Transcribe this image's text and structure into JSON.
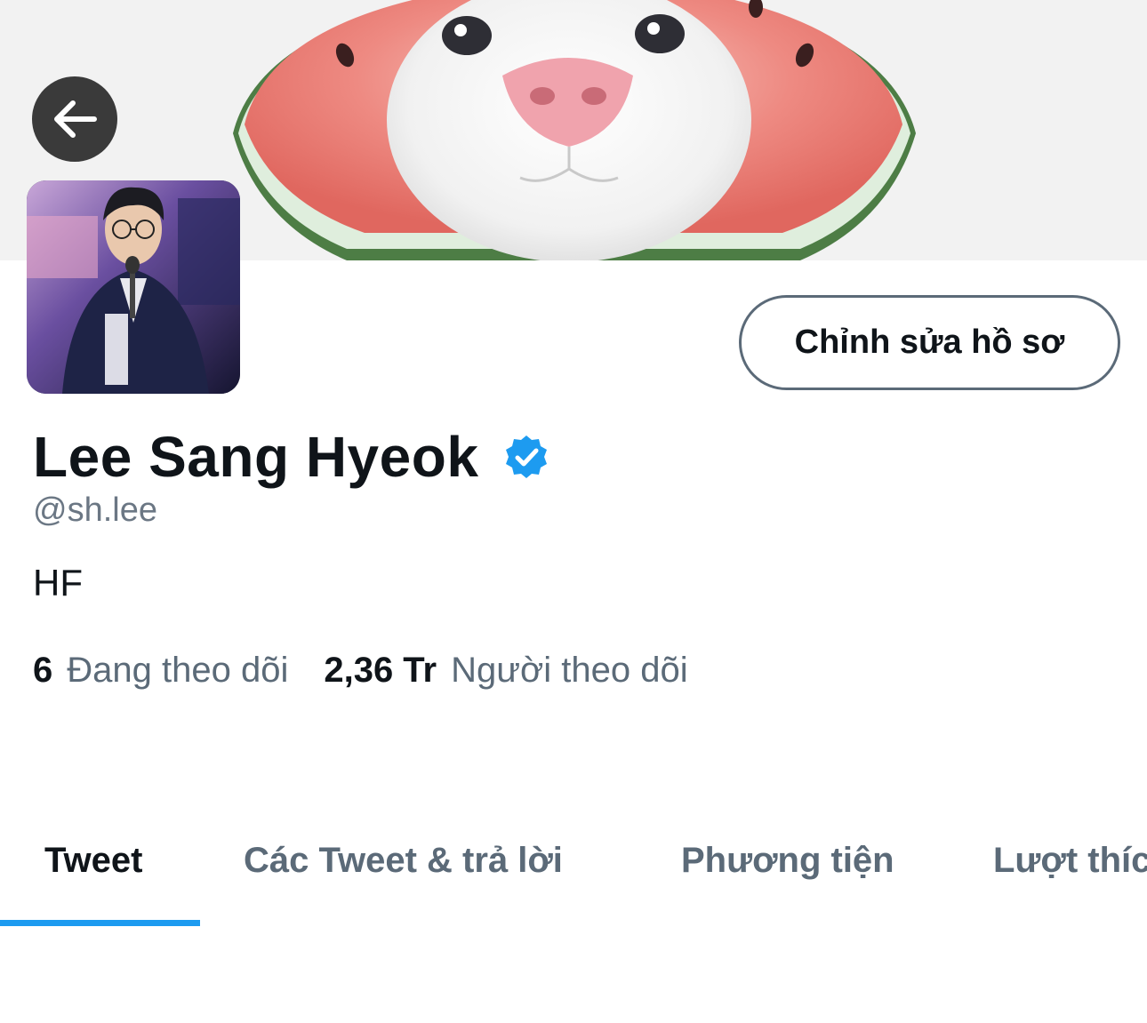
{
  "header": {
    "banner_icon": "cat-watermelon-banner",
    "back_icon": "arrow-left-icon"
  },
  "profile": {
    "avatar_icon": "profile-photo",
    "display_name": "Lee Sang Hyeok",
    "verified_icon": "verified-badge-icon",
    "handle": "@sh.lee",
    "bio": "HF",
    "edit_button_label": "Chỉnh sửa hồ sơ"
  },
  "stats": {
    "following_count": "6",
    "following_label": "Đang theo dõi",
    "followers_count": "2,36 Tr",
    "followers_label": "Người theo dõi"
  },
  "tabs": [
    {
      "label": "Tweet",
      "active": true
    },
    {
      "label": "Các Tweet & trả lời",
      "active": false
    },
    {
      "label": "Phương tiện",
      "active": false
    },
    {
      "label": "Lượt thích",
      "active": false
    }
  ],
  "colors": {
    "accent": "#1d9bf0",
    "text_primary": "#0f1419",
    "text_secondary": "#5b6a78"
  }
}
